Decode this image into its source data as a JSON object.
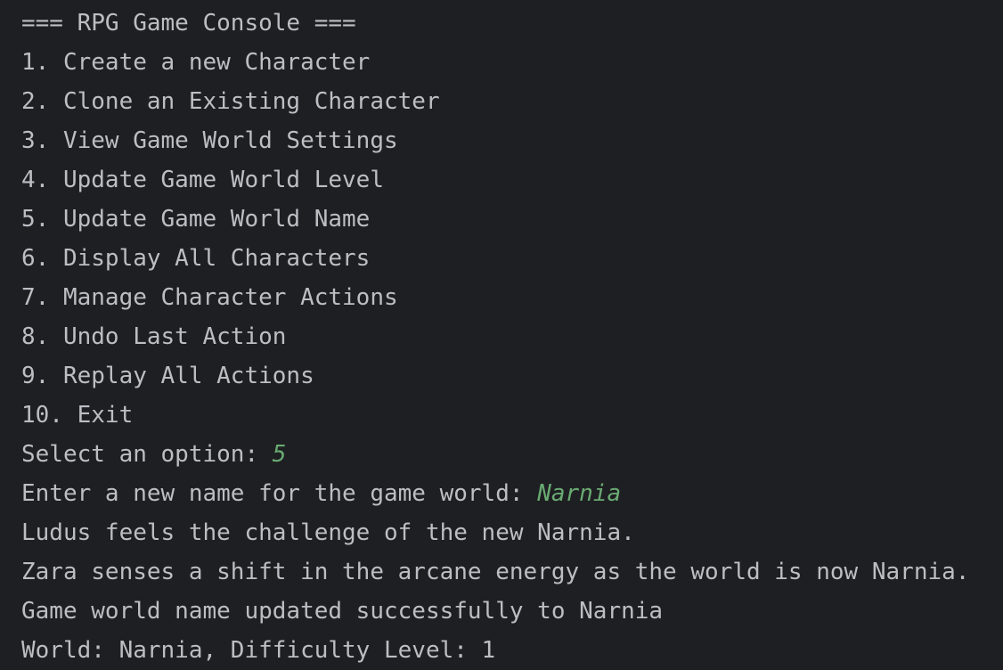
{
  "console": {
    "title": "=== RPG Game Console ===",
    "menu": [
      "1. Create a new Character",
      "2. Clone an Existing Character",
      "3. View Game World Settings",
      "4. Update Game World Level",
      "5. Update Game World Name",
      "6. Display All Characters",
      "7. Manage Character Actions",
      "8. Undo Last Action",
      "9. Replay All Actions",
      "10. Exit"
    ],
    "select_prompt": "Select an option: ",
    "select_value": "5",
    "name_prompt": "Enter a new name for the game world: ",
    "name_value": "Narnia",
    "output": [
      "Ludus feels the challenge of the new Narnia.",
      "Zara senses a shift in the arcane energy as the world is now Narnia.",
      "Game world name updated successfully to Narnia",
      "World: Narnia, Difficulty Level: 1"
    ]
  },
  "colors": {
    "background": "#1e1f22",
    "text": "#bcbec4",
    "user_input": "#6aab73"
  }
}
